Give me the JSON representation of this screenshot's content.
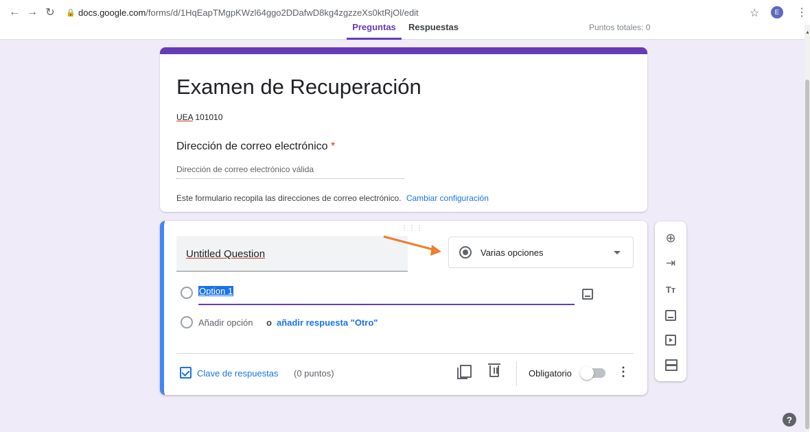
{
  "browser": {
    "url_domain": "docs.google.com",
    "url_path": "/forms/d/1HqEapTMgpKWzl64ggo2DDafwD8kg4zgzzeXs0ktRjOl/edit",
    "profile_initial": "E"
  },
  "header": {
    "tabs": [
      {
        "label": "Preguntas",
        "active": true
      },
      {
        "label": "Respuestas",
        "active": false
      }
    ],
    "total_points": "Puntos totales: 0"
  },
  "form": {
    "title": "Examen de Recuperación",
    "description_prefix": "UEA",
    "description_rest": " 101010",
    "email_label": "Dirección de correo electrónico",
    "required_mark": "*",
    "email_placeholder": "Dirección de correo electrónico válida",
    "collect_note": "Este formulario recopila las direcciones de correo electrónico.",
    "change_settings_link": "Cambiar configuración"
  },
  "question": {
    "title": "Untitled Question",
    "type_label": "Varias opciones",
    "option_1": "Option 1",
    "add_option": "Añadir opción",
    "or_text": "o",
    "add_other": "añadir respuesta \"Otro\"",
    "answer_key": "Clave de respuestas",
    "points": "(0 puntos)",
    "required_label": "Obligatorio",
    "required_on": false
  },
  "colors": {
    "theme": "#673ab7",
    "background": "#f0ebf8",
    "active_question_border": "#4285f4",
    "link": "#1a73e8",
    "annotation_arrow": "#ed7d31"
  },
  "icons": [
    "back-icon",
    "forward-icon",
    "reload-icon",
    "lock-icon",
    "star-icon",
    "add-question-icon",
    "import-icon",
    "title-text-icon",
    "image-icon",
    "video-icon",
    "section-icon",
    "copy-icon",
    "trash-icon",
    "more-icon",
    "help-icon"
  ]
}
